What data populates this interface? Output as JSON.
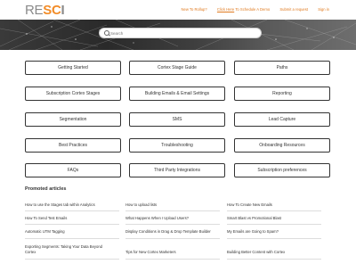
{
  "brand": {
    "logo_re": "RE",
    "logo_s": "S",
    "logo_c": "C",
    "logo_i": "I"
  },
  "topnav": {
    "need_rollup": "New To Rollup?",
    "click_here": "Click Here",
    "schedule_demo": "To Schedule A Demo",
    "submit_request": "Submit a request",
    "sign_in": "Sign in"
  },
  "search": {
    "placeholder": "Search"
  },
  "categories": [
    "Getting Started",
    "Cortex Stage Guide",
    "Paths",
    "Subscription Cortex Stages",
    "Building Emails & Email Settings",
    "Reporting",
    "Segmentation",
    "SMS",
    "Lead Capture",
    "Best Practices",
    "Troubleshooting",
    "Onboarding Resources",
    "FAQs",
    "Third Party Integrations",
    "Subscription preferences"
  ],
  "promoted": {
    "title": "Promoted articles",
    "articles": [
      "How to use the Stages tab within Analytics",
      "How to upload lists",
      "How To Create New Emails",
      "How To Send Test Emails",
      "What Happens When I Upload Users?",
      "Smart Blast vs Promotional Blast",
      "Automatic UTM Tagging",
      "Display Conditions in Drag & Drop Template Builder",
      "My Emails are Going to Spam?",
      "Exporting Segments: Taking Your Data Beyond Cortex",
      "Tips for New Cortex Marketers",
      "Building Better Content with Cortex"
    ]
  },
  "colors": {
    "accent": "#e07a1f",
    "logo_orange": "#f28c28",
    "border": "#333333"
  },
  "icons": {
    "search": "search-icon"
  }
}
